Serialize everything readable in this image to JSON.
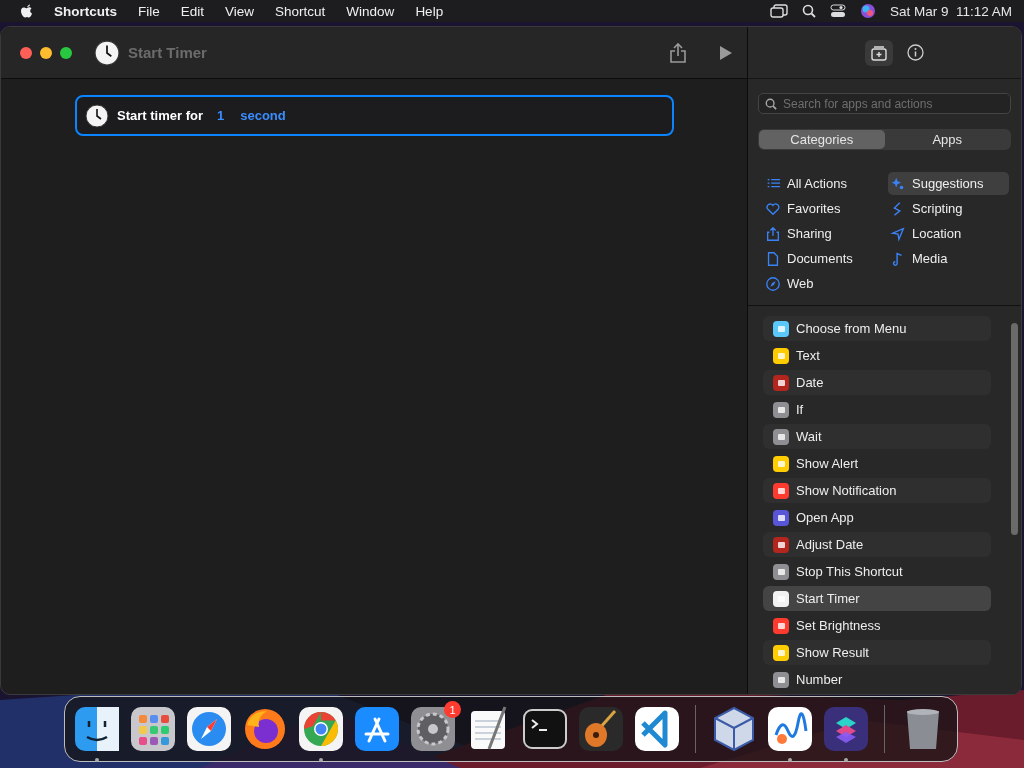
{
  "menu_bar": {
    "app": "Shortcuts",
    "menus": [
      "File",
      "Edit",
      "View",
      "Shortcut",
      "Window",
      "Help"
    ],
    "clock": "Sat Mar 9  11:12 AM"
  },
  "window": {
    "title": "Start Timer"
  },
  "action": {
    "label": "Start timer for",
    "value": "1",
    "unit": "second"
  },
  "sidebar": {
    "search": {
      "placeholder": "Search for apps and actions"
    },
    "segments": [
      {
        "label": "Categories",
        "selected": true
      },
      {
        "label": "Apps",
        "selected": false
      }
    ],
    "categories": [
      {
        "label": "All Actions",
        "kind": "list",
        "selected": false
      },
      {
        "label": "Suggestions",
        "kind": "sparkle",
        "selected": true
      },
      {
        "label": "Favorites",
        "kind": "heart",
        "selected": false
      },
      {
        "label": "Scripting",
        "kind": "script",
        "selected": false
      },
      {
        "label": "Sharing",
        "kind": "share",
        "selected": false
      },
      {
        "label": "Location",
        "kind": "location",
        "selected": false
      },
      {
        "label": "Documents",
        "kind": "document",
        "selected": false
      },
      {
        "label": "Media",
        "kind": "music",
        "selected": false
      },
      {
        "label": "Web",
        "kind": "compass",
        "selected": false
      }
    ],
    "actions": [
      {
        "label": "Choose from Menu",
        "color": "#5ac8fa",
        "selected": false
      },
      {
        "label": "Text",
        "color": "#ffcc00",
        "selected": false
      },
      {
        "label": "Date",
        "color": "#b3261e",
        "selected": false
      },
      {
        "label": "If",
        "color": "#8e8e93",
        "selected": false
      },
      {
        "label": "Wait",
        "color": "#8e8e93",
        "selected": false
      },
      {
        "label": "Show Alert",
        "color": "#ffcc00",
        "selected": false
      },
      {
        "label": "Show Notification",
        "color": "#ff3b30",
        "selected": false
      },
      {
        "label": "Open App",
        "color": "#5856d6",
        "selected": false
      },
      {
        "label": "Adjust Date",
        "color": "#b3261e",
        "selected": false
      },
      {
        "label": "Stop This Shortcut",
        "color": "#8e8e93",
        "selected": false
      },
      {
        "label": "Start Timer",
        "color": "#f2f2f2",
        "selected": true
      },
      {
        "label": "Set Brightness",
        "color": "#ff3b30",
        "selected": false
      },
      {
        "label": "Show Result",
        "color": "#ffcc00",
        "selected": false
      },
      {
        "label": "Number",
        "color": "#8e8e93",
        "selected": false
      }
    ]
  },
  "dock": [
    {
      "kind": "finder",
      "running": true
    },
    {
      "kind": "launchpad",
      "running": false
    },
    {
      "kind": "safari",
      "running": false
    },
    {
      "kind": "firefox",
      "running": false
    },
    {
      "kind": "chrome",
      "running": true
    },
    {
      "kind": "appstore",
      "running": false
    },
    {
      "kind": "settings",
      "running": false,
      "badge": "1"
    },
    {
      "kind": "textedit",
      "running": false
    },
    {
      "kind": "terminal",
      "running": false
    },
    {
      "kind": "garageband",
      "running": false
    },
    {
      "kind": "vscode",
      "running": false
    },
    {
      "kind": "separator"
    },
    {
      "kind": "virtualbox",
      "running": false
    },
    {
      "kind": "freeform",
      "running": true
    },
    {
      "kind": "shortcuts",
      "running": true
    },
    {
      "kind": "separator"
    },
    {
      "kind": "trash",
      "running": false
    }
  ]
}
